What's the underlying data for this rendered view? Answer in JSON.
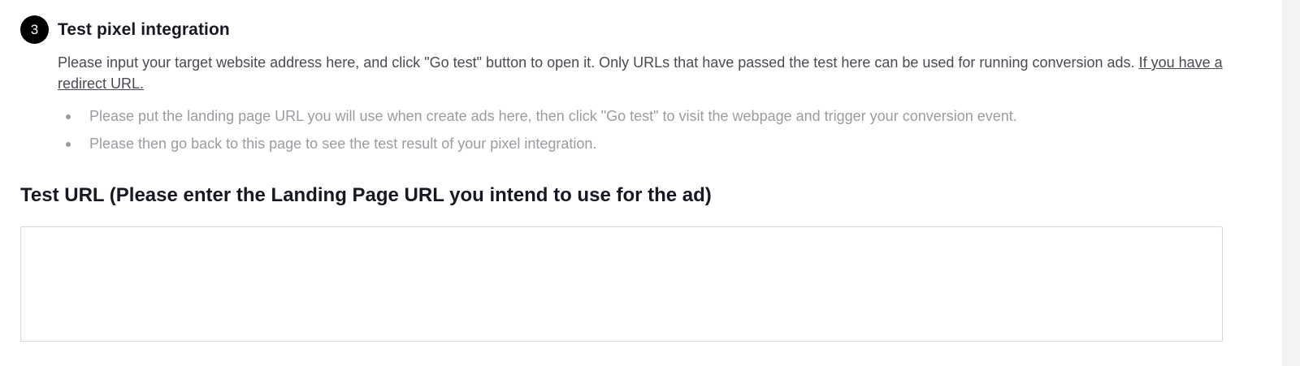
{
  "step": {
    "number": "3",
    "title": "Test pixel integration"
  },
  "description": {
    "text": "Please input your target website address here, and click \"Go test\" button to open it. Only URLs that have passed the test here can be used for running conversion ads. ",
    "link_label": "If you have a redirect URL."
  },
  "tips": [
    "Please put the landing page URL you will use when create ads here, then click \"Go test\" to visit the webpage and trigger your conversion event.",
    "Please then go back to this page to see the test result of your pixel integration."
  ],
  "test_url": {
    "label": "Test URL (Please enter the Landing Page URL you intend to use for the ad)",
    "value": "",
    "placeholder": ""
  },
  "colors": {
    "badge": "#000000",
    "heading": "#161823",
    "body_text": "#4a4b52",
    "muted_text": "#9b9ca2",
    "input_border": "#d7d8db",
    "right_strip": "#f2f3f5"
  }
}
